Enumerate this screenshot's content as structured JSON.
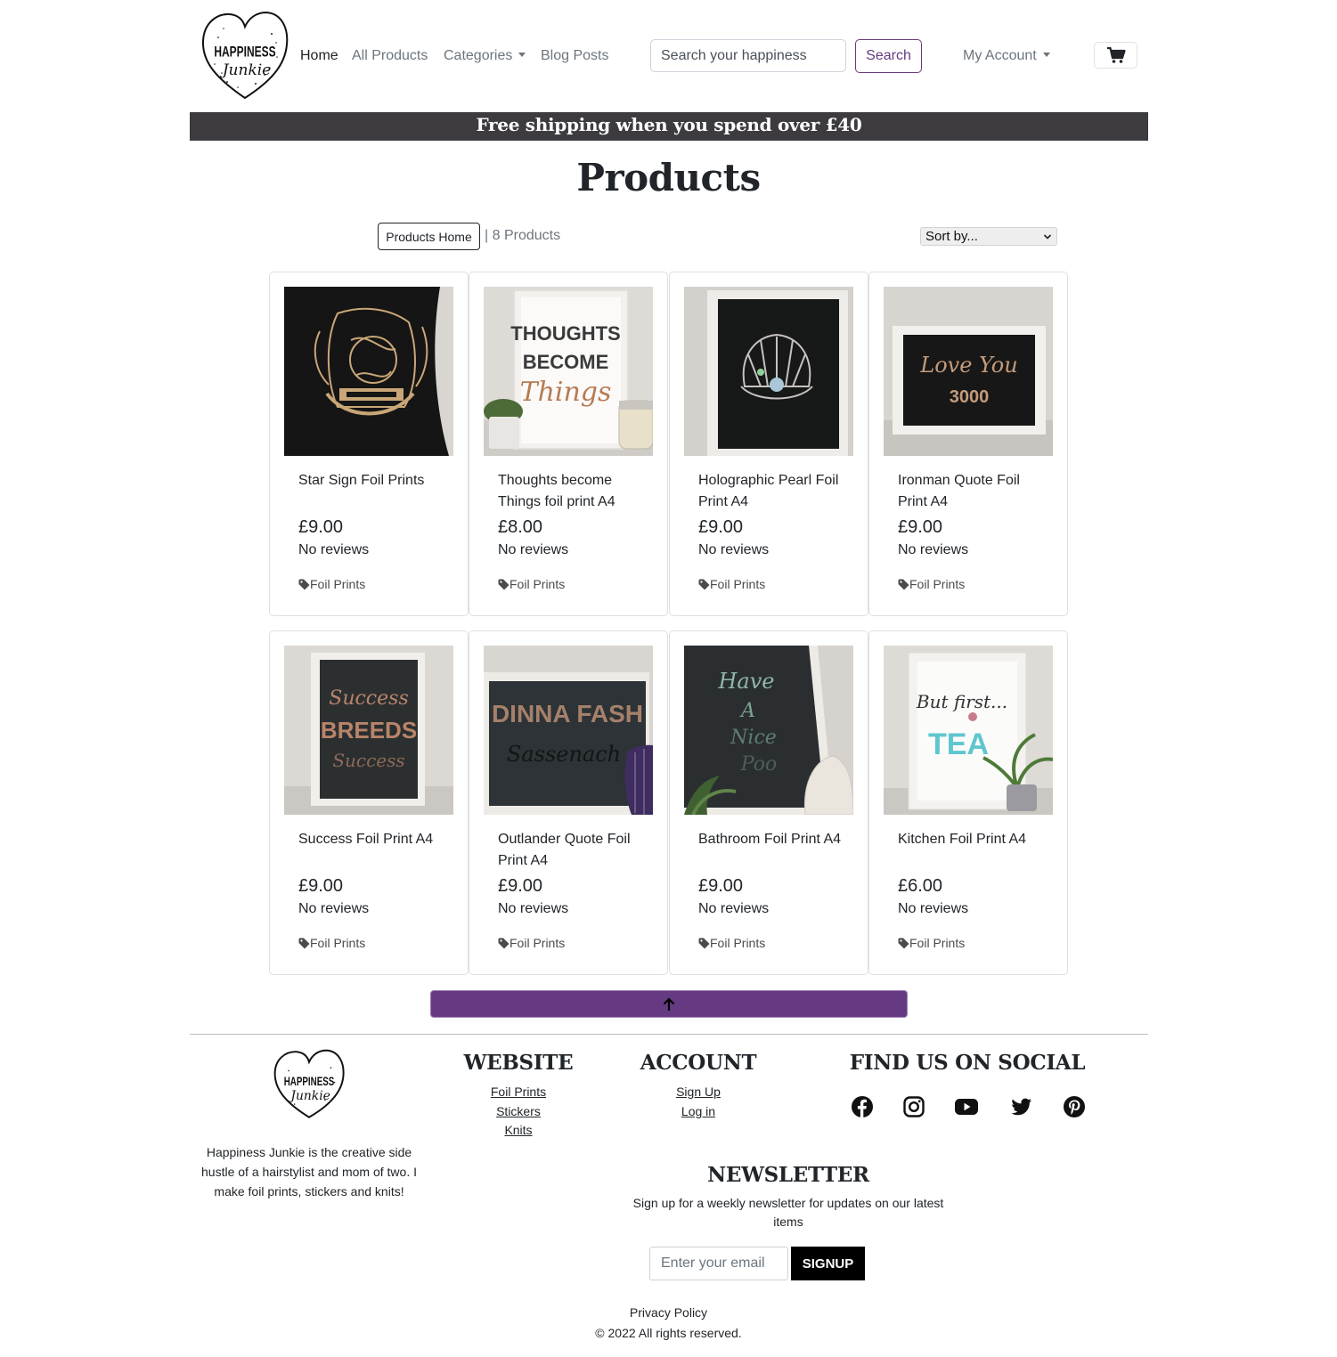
{
  "brand": {
    "logo_line1": "HAPPINESS",
    "logo_line2": "Junkie"
  },
  "nav": {
    "links": [
      "Home",
      "All Products",
      "Categories",
      "Blog Posts"
    ],
    "search_placeholder": "Search your happiness",
    "search_button": "Search",
    "account": "My Account",
    "cart_icon": "cart-icon"
  },
  "banner": "Free shipping when you spend over £40",
  "page_title": "Products",
  "toolbar": {
    "home_button": "Products Home",
    "count": "| 8 Products",
    "sort_label": "Sort by..."
  },
  "products": [
    {
      "name": "Star Sign Foil Prints",
      "price": "£9.00",
      "reviews": "No reviews",
      "tag": "Foil Prints"
    },
    {
      "name": "Thoughts become Things foil print A4",
      "price": "£8.00",
      "reviews": "No reviews",
      "tag": "Foil Prints"
    },
    {
      "name": "Holographic Pearl Foil Print A4",
      "price": "£9.00",
      "reviews": "No reviews",
      "tag": "Foil Prints"
    },
    {
      "name": "Ironman Quote Foil Print A4",
      "price": "£9.00",
      "reviews": "No reviews",
      "tag": "Foil Prints"
    },
    {
      "name": "Success Foil Print A4",
      "price": "£9.00",
      "reviews": "No reviews",
      "tag": "Foil Prints"
    },
    {
      "name": "Outlander Quote Foil Print A4",
      "price": "£9.00",
      "reviews": "No reviews",
      "tag": "Foil Prints"
    },
    {
      "name": "Bathroom Foil Print A4",
      "price": "£9.00",
      "reviews": "No reviews",
      "tag": "Foil Prints"
    },
    {
      "name": "Kitchen Foil Print A4",
      "price": "£6.00",
      "reviews": "No reviews",
      "tag": "Foil Prints"
    }
  ],
  "artwork_text": {
    "thoughts": [
      "THOUGHTS",
      "BECOME",
      "Things"
    ],
    "ironman": [
      "Love You",
      "3000"
    ],
    "success": [
      "Success",
      "BREEDS",
      "Success"
    ],
    "outlander": [
      "DINNA FASH",
      "Sassenach"
    ],
    "bathroom": [
      "Have",
      "A",
      "Nice",
      "Poo"
    ],
    "kitchen": [
      "But first...",
      "TEA"
    ]
  },
  "footer": {
    "about": "Happiness Junkie is the creative side hustle of a hairstylist and mom of two. I make foil prints, stickers and knits!",
    "website_heading": "WEBSITE",
    "website_links": [
      "Foil Prints",
      "Stickers",
      "Knits"
    ],
    "account_heading": "ACCOUNT",
    "account_links": [
      "Sign Up",
      "Log in"
    ],
    "social_heading": "FIND US ON SOCIAL",
    "social_icons": [
      "facebook-icon",
      "instagram-icon",
      "youtube-icon",
      "twitter-icon",
      "pinterest-icon"
    ],
    "newsletter_heading": "NEWSLETTER",
    "newsletter_text": "Sign up for a weekly newsletter for updates on our latest items",
    "email_placeholder": "Enter your email",
    "signup_button": "SIGNUP",
    "privacy": "Privacy Policy",
    "copyright": "© 2022 All rights reserved."
  },
  "colors": {
    "accent": "#663a82",
    "banner_bg": "#3d3b40",
    "text": "#212529",
    "muted": "#6c757d"
  }
}
